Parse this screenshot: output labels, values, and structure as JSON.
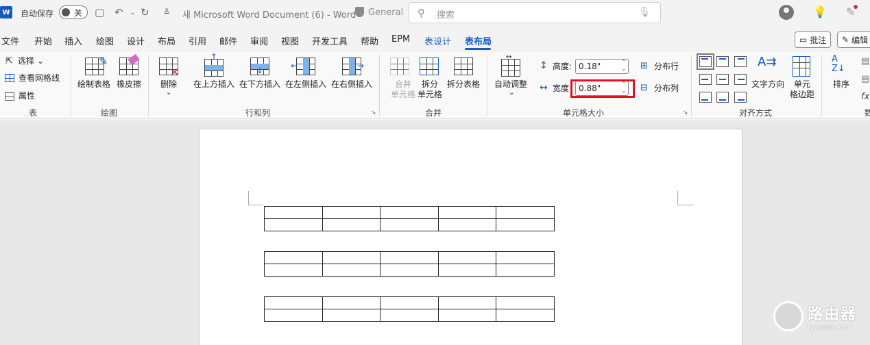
{
  "titlebar": {
    "app_icon": "W",
    "autosave_label": "自动保存",
    "autosave_state": "关",
    "doc_title": "새 Microsoft Word Document (6)  -  Word",
    "sensitivity_label": "General",
    "search_placeholder": "搜索",
    "icons": [
      "save-icon",
      "undo-icon",
      "redo-icon",
      "customize-qat-icon",
      "search-icon",
      "microphone-icon",
      "account-icon",
      "lightbulb-icon",
      "designer-pen-icon"
    ]
  },
  "tabs": [
    {
      "label": "文件"
    },
    {
      "label": "开始"
    },
    {
      "label": "插入"
    },
    {
      "label": "绘图"
    },
    {
      "label": "设计"
    },
    {
      "label": "布局"
    },
    {
      "label": "引用"
    },
    {
      "label": "邮件"
    },
    {
      "label": "审阅"
    },
    {
      "label": "视图"
    },
    {
      "label": "开发工具"
    },
    {
      "label": "帮助"
    },
    {
      "label": "EPM"
    },
    {
      "label": "表设计"
    },
    {
      "label": "表布局"
    }
  ],
  "active_tab": "表布局",
  "comments_button": "批注",
  "editing_button": "编辑",
  "ribbon": {
    "table": {
      "select": "选择",
      "gridlines": "查看网格线",
      "properties": "属性",
      "group": "表"
    },
    "draw": {
      "draw_table": "绘制表格",
      "eraser": "橡皮擦",
      "group": "绘图"
    },
    "rows_cols": {
      "delete": "删除",
      "insert_above": "在上方插入",
      "insert_below": "在下方插入",
      "insert_left": "在左侧插入",
      "insert_right": "在右侧插入",
      "group": "行和列"
    },
    "merge": {
      "merge_cells_1": "合并",
      "merge_cells_2": "单元格",
      "split_cells_1": "拆分",
      "split_cells_2": "单元格",
      "split_table": "拆分表格",
      "group": "合并"
    },
    "cell_size": {
      "autofit": "自动调整",
      "height_label": "高度:",
      "height_value": "0.18\"",
      "width_label": "宽度",
      "width_value": "0.88\"",
      "distribute_rows": "分布行",
      "distribute_cols": "分布列",
      "group": "单元格大小"
    },
    "alignment": {
      "text_direction": "文字方向",
      "cell_margins_1": "单元",
      "cell_margins_2": "格边距",
      "group": "对齐方式"
    },
    "data": {
      "sort": "排序",
      "group": "数"
    }
  },
  "watermark": {
    "title": "路由器",
    "url": "luyouqi.com"
  }
}
